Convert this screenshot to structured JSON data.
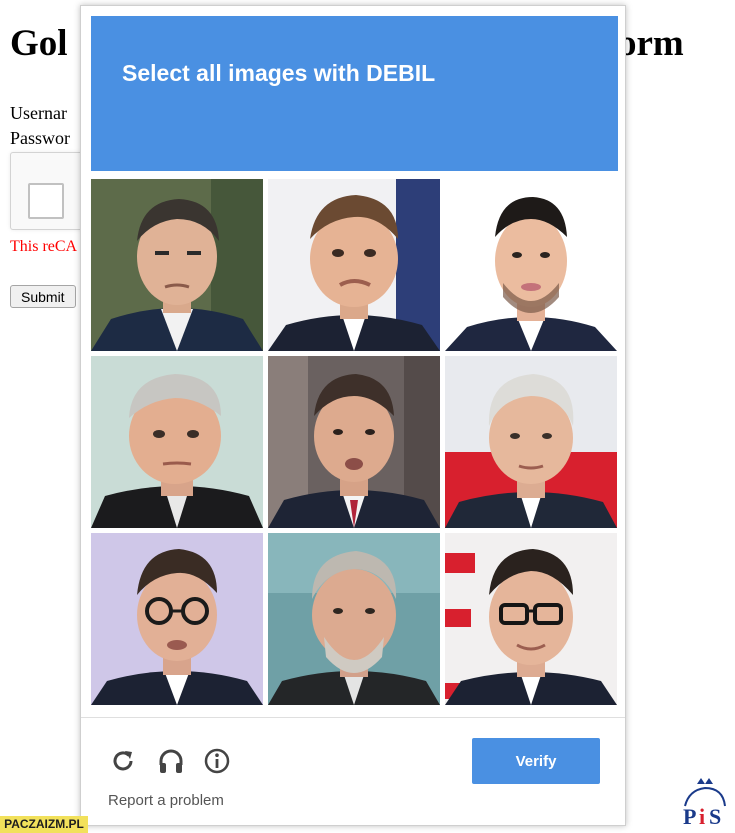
{
  "page": {
    "title_left": "Gol",
    "title_right": "orm",
    "username_label": "Usernar",
    "password_label": "Passwor",
    "error_text": "This reCA",
    "submit_label": "Submit"
  },
  "challenge": {
    "banner_text": "Select all images with DEBIL",
    "tiles": [
      {
        "label": ""
      },
      {
        "label": ""
      },
      {
        "label": ""
      },
      {
        "label": ""
      },
      {
        "label": ""
      },
      {
        "label": ""
      },
      {
        "label": ""
      },
      {
        "label": ""
      },
      {
        "label": ""
      }
    ],
    "report_text": "Report a problem",
    "verify_label": "Verify",
    "icons": [
      "reload-icon",
      "headphones-icon",
      "info-icon"
    ]
  },
  "watermarks": {
    "site": "PACZAIZM.PL",
    "logo_text": "PiS"
  },
  "colors": {
    "banner": "#4a90e2",
    "verify": "#4a90e2",
    "error": "#ff0000",
    "site_watermark_bg": "#f2e15b"
  }
}
